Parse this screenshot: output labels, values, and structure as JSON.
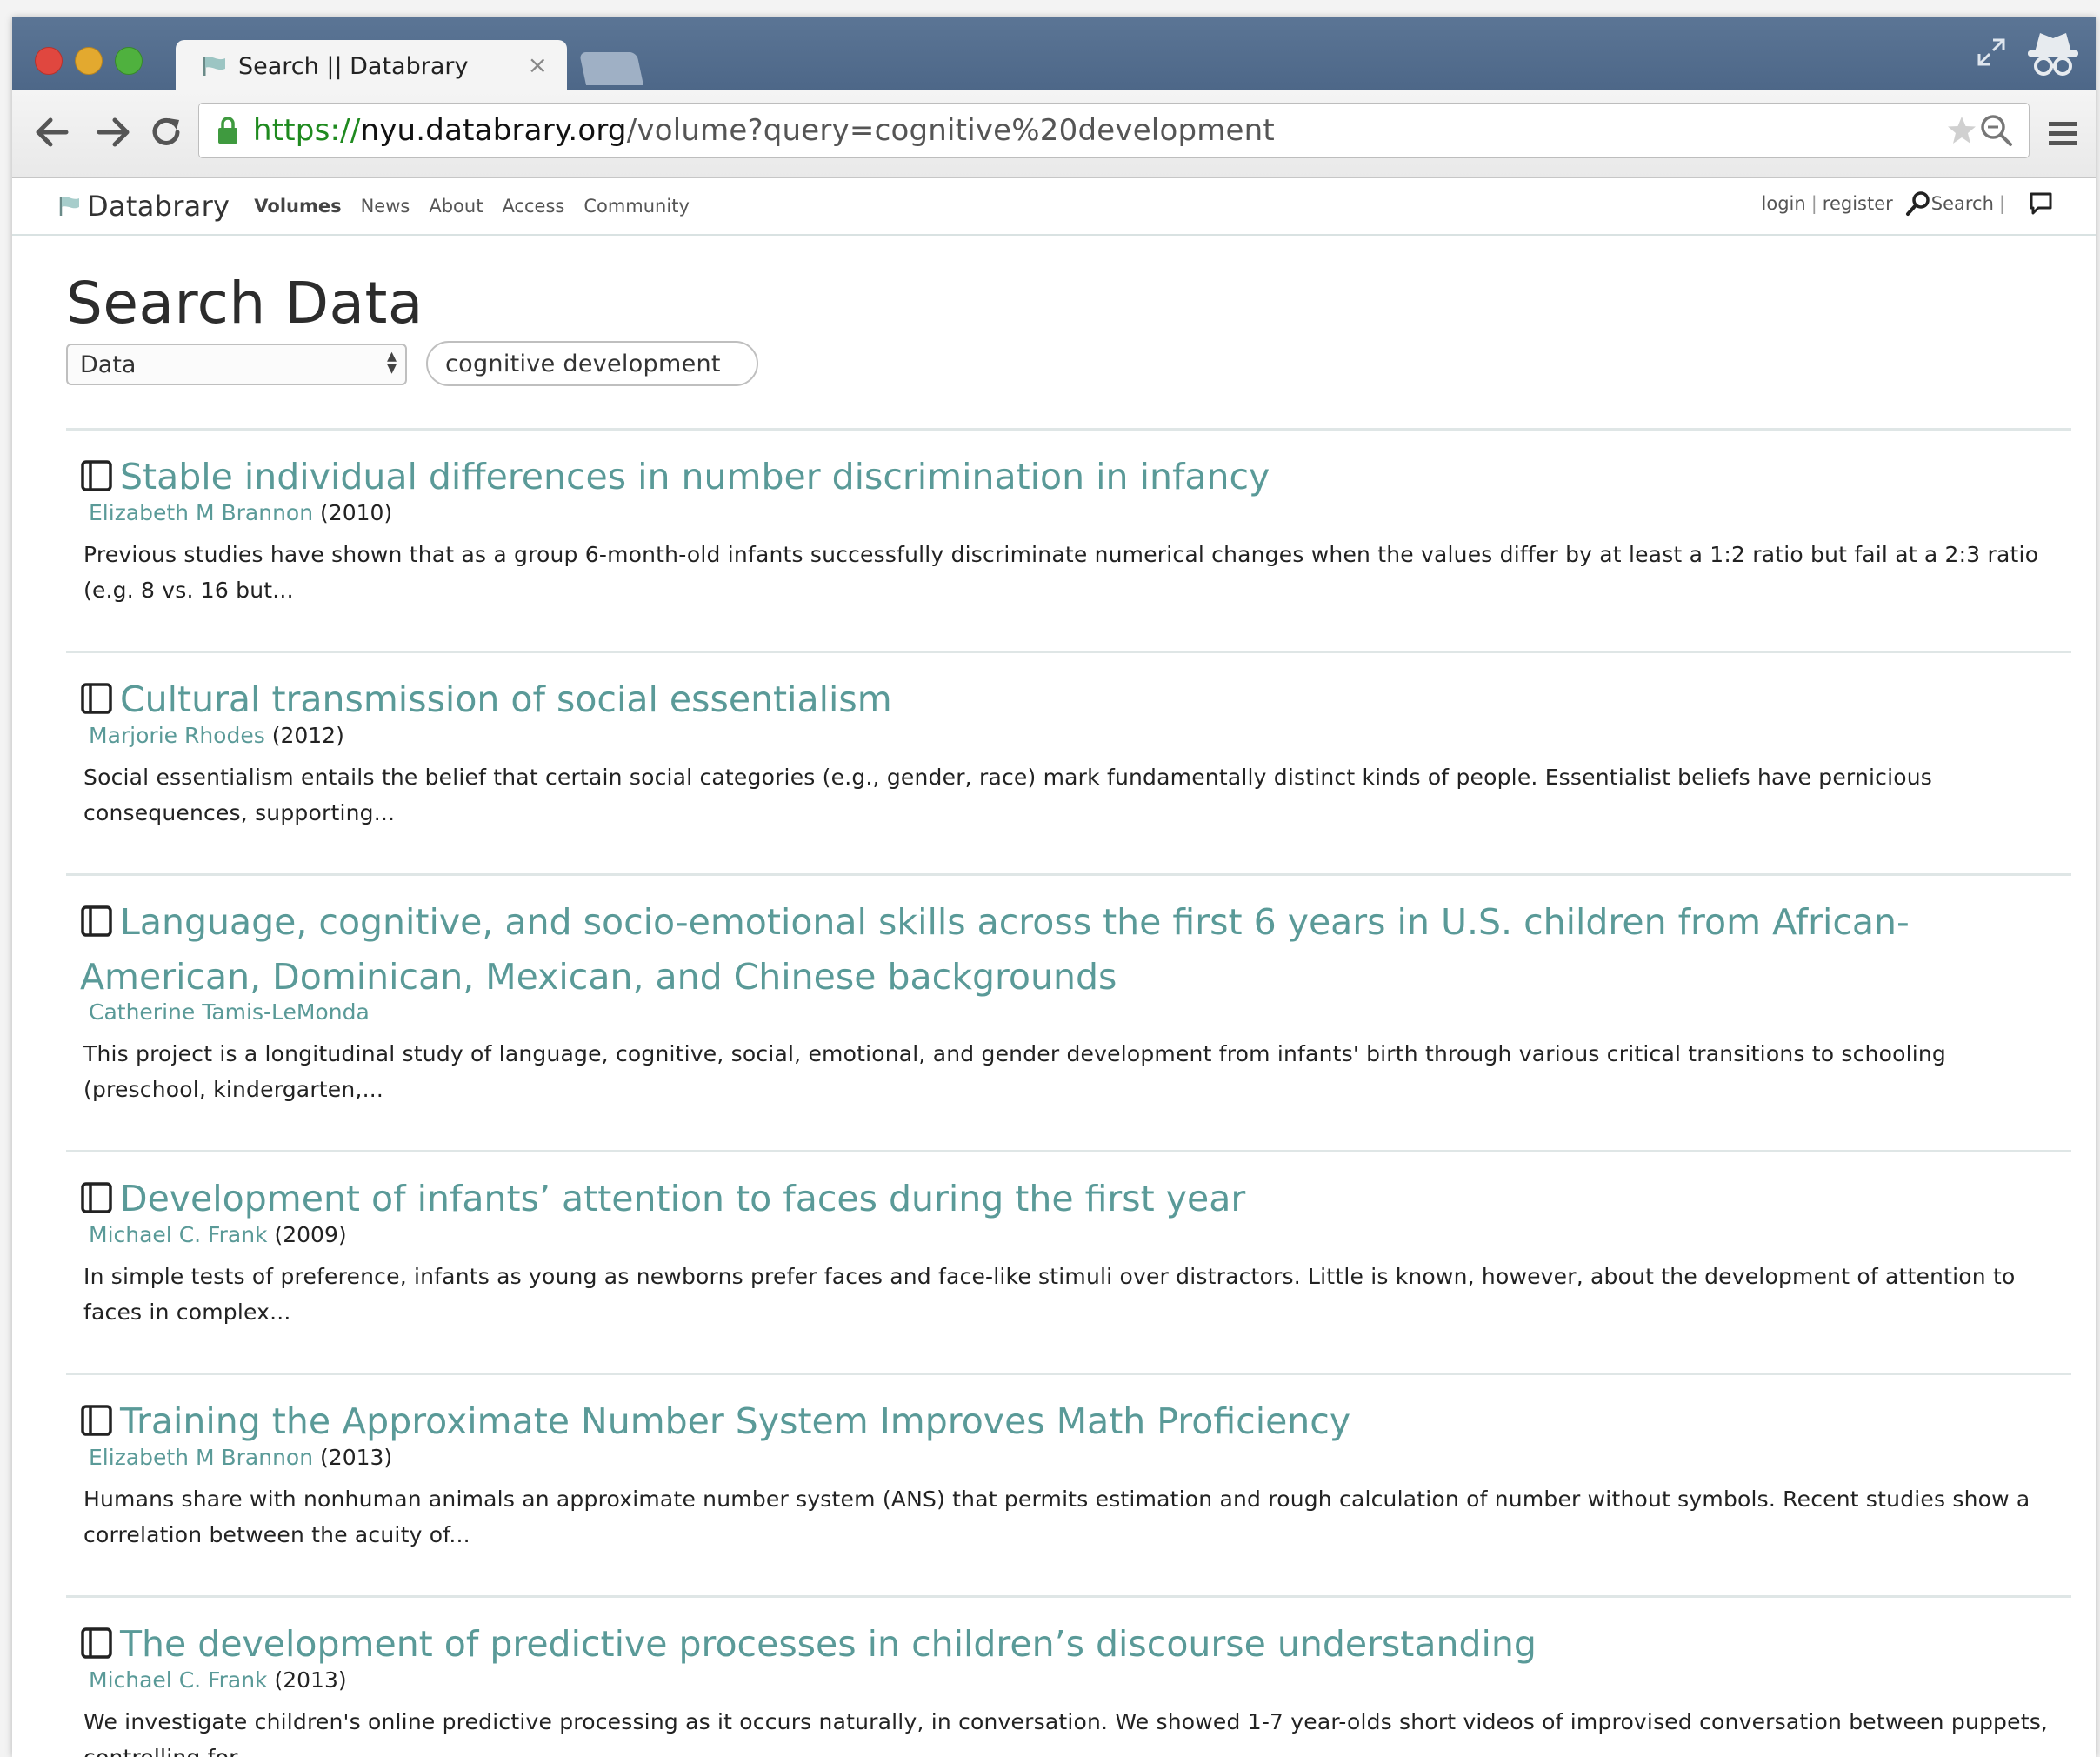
{
  "browser": {
    "tab_title": "Search || Databrary",
    "tab_close": "×",
    "url_scheme": "https://",
    "url_host": "nyu.databrary.org",
    "url_path": "/volume?query=cognitive%20development"
  },
  "site": {
    "logo_text": "Databrary",
    "nav": [
      "Volumes",
      "News",
      "About",
      "Access",
      "Community"
    ],
    "login": "login",
    "register": "register",
    "search": "Search"
  },
  "page": {
    "title": "Search Data",
    "filter_value": "Data",
    "query_value": "cognitive development"
  },
  "results": [
    {
      "title": "Stable individual differences in number discrimination in infancy",
      "author": "Elizabeth M Brannon",
      "year": "(2010)",
      "snippet": "Previous studies have shown that as a group 6-month-old infants successfully discriminate numerical changes when the values differ by at least a 1:2 ratio but fail at a 2:3 ratio (e.g. 8 vs. 16 but..."
    },
    {
      "title": "Cultural transmission of social essentialism",
      "author": "Marjorie Rhodes",
      "year": "(2012)",
      "snippet": "Social essentialism entails the belief that certain social categories (e.g., gender, race) mark fundamentally distinct kinds of people. Essentialist beliefs have pernicious consequences, supporting..."
    },
    {
      "title": "Language, cognitive, and socio-emotional skills across the first 6 years in U.S. children from African-American, Dominican, Mexican, and Chinese backgrounds",
      "author": "Catherine Tamis-LeMonda",
      "year": "",
      "snippet": "This project is a longitudinal study of language, cognitive, social, emotional, and gender development from infants' birth through various critical transitions to schooling (preschool, kindergarten,..."
    },
    {
      "title": "Development of infants’ attention to faces during the first year",
      "author": "Michael C. Frank",
      "year": "(2009)",
      "snippet": "In simple tests of preference, infants as young as newborns prefer faces and face-like stimuli over distractors. Little is known, however, about the development of attention to faces in complex..."
    },
    {
      "title": "Training the Approximate Number System Improves Math Proficiency",
      "author": "Elizabeth M Brannon",
      "year": "(2013)",
      "snippet": "Humans share with nonhuman animals an approximate number system (ANS) that permits estimation and rough calculation of number without symbols. Recent studies show a correlation between the acuity of..."
    },
    {
      "title": "The development of predictive processes in children’s discourse understanding",
      "author": "Michael C. Frank",
      "year": "(2013)",
      "snippet": "We investigate children's online predictive processing as it occurs naturally, in conversation. We showed 1-7 year-olds short videos of improvised conversation between puppets, controlling for..."
    }
  ],
  "colors": {
    "accent": "#5a9a98",
    "titlebar": "#5b7595"
  }
}
